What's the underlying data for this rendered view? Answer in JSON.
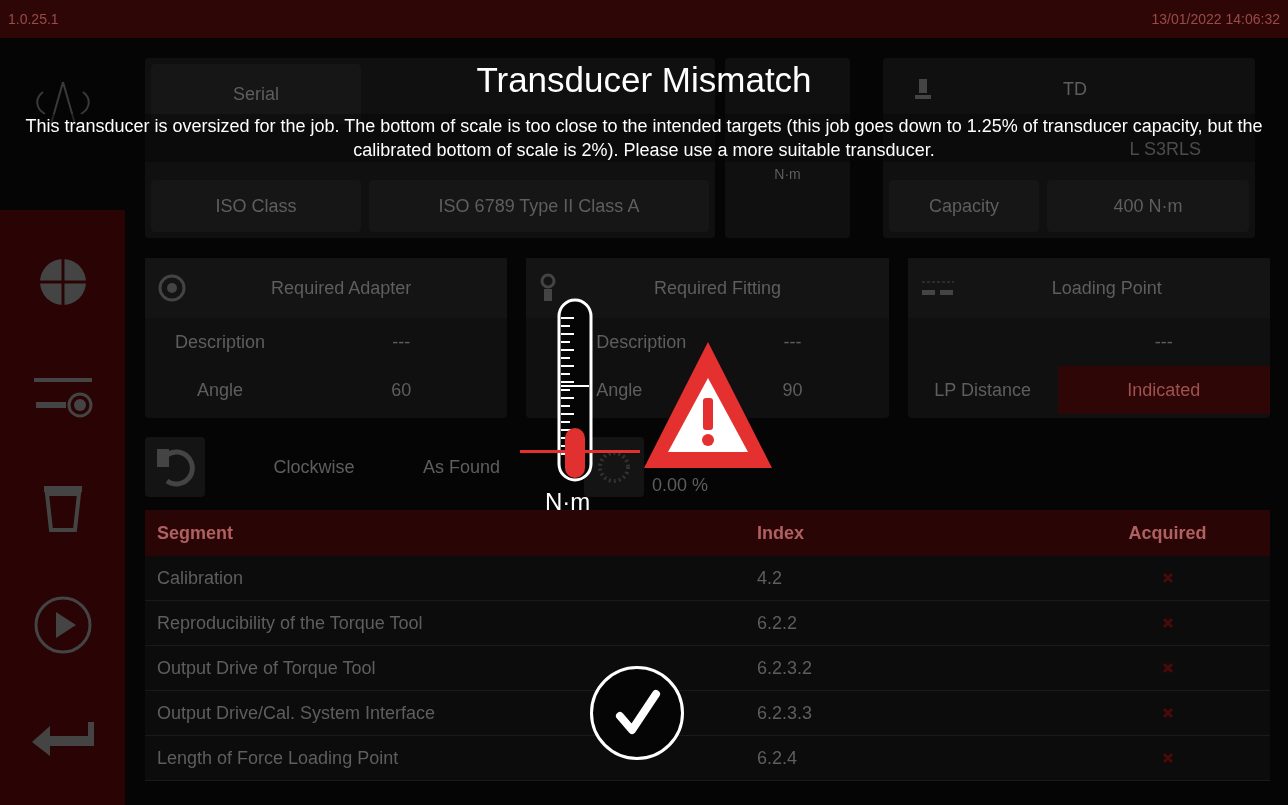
{
  "status_bar": {
    "version": "1.0.25.1",
    "datetime": "13/01/2022 14:06:32"
  },
  "identity": {
    "serial_label": "Serial",
    "iso_class_label": "ISO Class",
    "iso_class_value": "ISO 6789 Type II Class A",
    "unit": "N·m",
    "td_label": "TD",
    "td_value": "L S3RLS",
    "capacity_label": "Capacity",
    "capacity_value": "400 N·m"
  },
  "panels": [
    {
      "title": "Required Adapter",
      "kind": "adapter",
      "rows": [
        {
          "label": "Description",
          "value": "---",
          "highlighted": false
        },
        {
          "label": "Angle",
          "value": "60",
          "highlighted": false
        }
      ]
    },
    {
      "title": "Required Fitting",
      "kind": "fitting",
      "rows": [
        {
          "label": "Description",
          "value": "---",
          "highlighted": false
        },
        {
          "label": "Angle",
          "value": "90",
          "highlighted": false
        }
      ]
    },
    {
      "title": "Loading Point",
      "kind": "loading",
      "rows": [
        {
          "value": "---",
          "highlighted": false
        },
        {
          "label": "LP Distance",
          "value": "Indicated",
          "highlighted": true
        }
      ]
    }
  ],
  "direction": {
    "rotation": "Clockwise",
    "mode": "As Found",
    "deviation": "0.00 %"
  },
  "table": {
    "columns": [
      "Segment",
      "Index",
      "Acquired"
    ],
    "rows": [
      {
        "segment": "Calibration",
        "index": "4.2",
        "acquired": false
      },
      {
        "segment": "Reproducibility of the Torque Tool",
        "index": "6.2.2",
        "acquired": false
      },
      {
        "segment": "Output Drive of Torque Tool",
        "index": "6.2.3.2",
        "acquired": false
      },
      {
        "segment": "Output Drive/Cal. System Interface",
        "index": "6.2.3.3",
        "acquired": false
      },
      {
        "segment": "Length of Force Loading Point",
        "index": "6.2.4",
        "acquired": false
      }
    ]
  },
  "dialog": {
    "title": "Transducer Mismatch",
    "message": "This transducer is oversized for the job. The bottom of scale is too close to the intended targets (this job goes down to 1.25% of transducer capacity, but the calibrated bottom of scale is 2%). Please use a more suitable transducer.",
    "unit": "N·m"
  }
}
